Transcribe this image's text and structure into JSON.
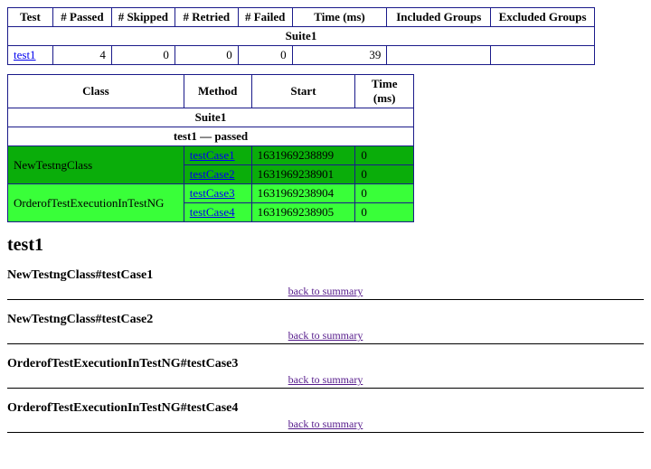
{
  "summary_table": {
    "headers": [
      "Test",
      "# Passed",
      "# Skipped",
      "# Retried",
      "# Failed",
      "Time (ms)",
      "Included Groups",
      "Excluded Groups"
    ],
    "suite_label": "Suite1",
    "row": {
      "test": "test1",
      "passed": "4",
      "skipped": "0",
      "retried": "0",
      "failed": "0",
      "time_ms": "39",
      "included": "",
      "excluded": ""
    }
  },
  "detail_table": {
    "headers": [
      "Class",
      "Method",
      "Start",
      "Time (ms)"
    ],
    "suite_label": "Suite1",
    "status_label": "test1 — passed",
    "rows": [
      {
        "class": "NewTestngClass",
        "method": "testCase1",
        "start": "1631969238899",
        "time_ms": "0",
        "shade": "dark",
        "show_class": true
      },
      {
        "class": "",
        "method": "testCase2",
        "start": "1631969238901",
        "time_ms": "0",
        "shade": "dark",
        "show_class": false
      },
      {
        "class": "OrderofTestExecutionInTestNG",
        "method": "testCase3",
        "start": "1631969238904",
        "time_ms": "0",
        "shade": "light",
        "show_class": true
      },
      {
        "class": "",
        "method": "testCase4",
        "start": "1631969238905",
        "time_ms": "0",
        "shade": "light",
        "show_class": false
      }
    ]
  },
  "details": {
    "title": "test1",
    "back_label": "back to summary",
    "cases": [
      "NewTestngClass#testCase1",
      "NewTestngClass#testCase2",
      "OrderofTestExecutionInTestNG#testCase3",
      "OrderofTestExecutionInTestNG#testCase4"
    ]
  }
}
